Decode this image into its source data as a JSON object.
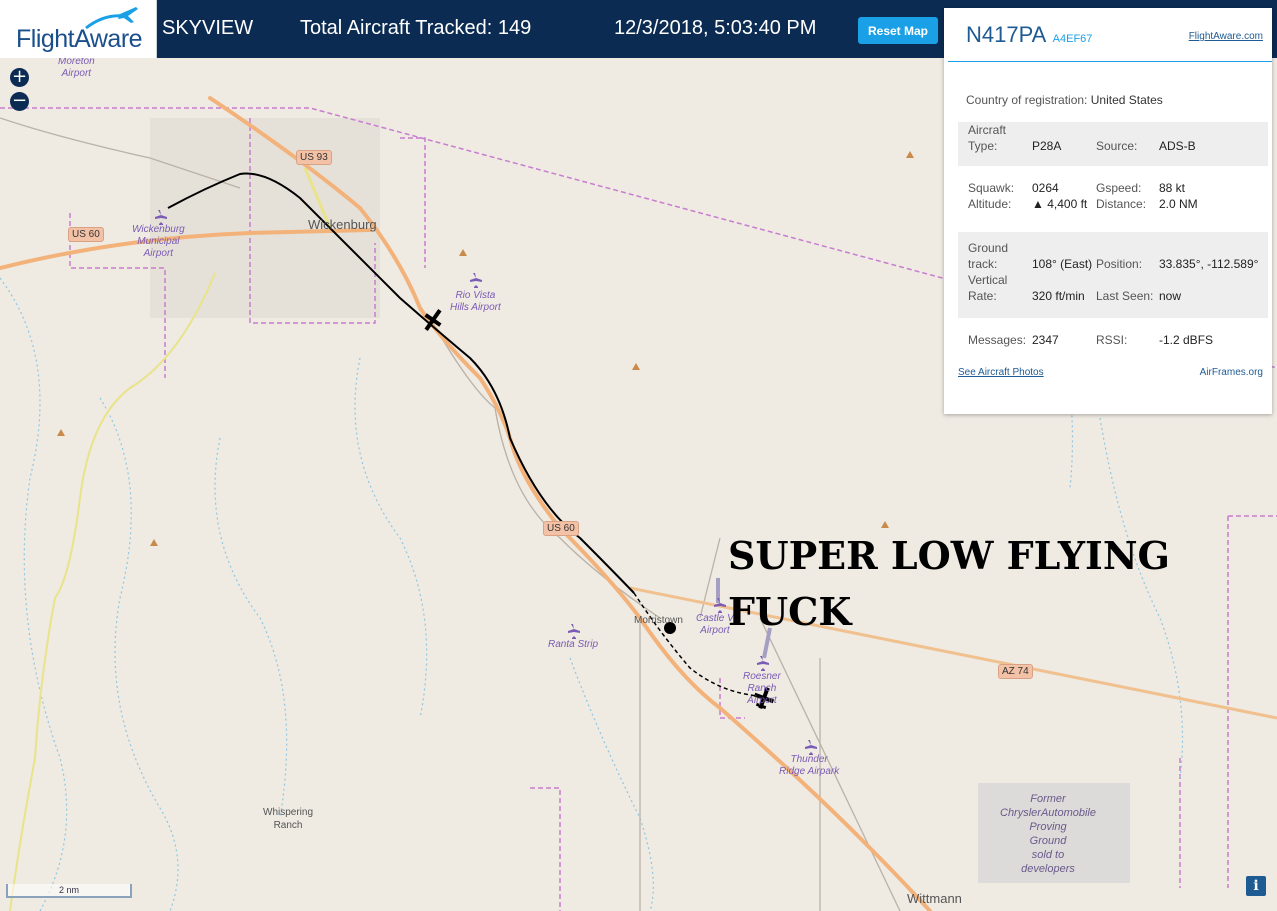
{
  "header": {
    "logo_text": "FlightAware",
    "app_name": "SKYVIEW",
    "total_tracked_label": "Total Aircraft Tracked: 149",
    "datetime": "12/3/2018, 5:03:40 PM",
    "reset_label": "Reset Map",
    "colors": {
      "bar": "#0b2b52",
      "accent": "#1aa0e6"
    }
  },
  "map": {
    "zoom_in": "+",
    "zoom_out": "−",
    "places": {
      "moreton": "Moreton\nAirport",
      "wickenburg": "Wickenburg",
      "wickenburg_airport": "Wickenburg\nMunicipal\nAirport",
      "rio_vista": "Rio Vista\nHills Airport",
      "morristown": "Morristown",
      "castle": "Castle V\nAirport",
      "ranta": "Ranta Strip",
      "roesner": "Roesner\nRanch\nAirport",
      "thunder": "Thunder\nRidge Airpark",
      "whispering": "Whispering\nRanch",
      "chrysler": "Former\nChryslerAutomobile\nProving\nGround\nsold to\ndevelopers",
      "wittmann": "Wittmann"
    },
    "shields": {
      "us93": "US 93",
      "us60_a": "US 60",
      "us60_b": "US 60",
      "az74": "AZ 74"
    },
    "annotation": "SUPER LOW FLYING FUCK",
    "scale": "2 nm",
    "info_icon": "i"
  },
  "panel": {
    "callsign": "N417PA",
    "hex": "A4EF67",
    "fa_link": "FlightAware.com",
    "country_label": "Country of registration:",
    "country_value": "United States",
    "type_label": "Aircraft\nType:",
    "type_value": "P28A",
    "source_label": "Source:",
    "source_value": "ADS-B",
    "squawk_label": "Squawk:",
    "squawk_value": "0264",
    "altitude_label": "Altitude:",
    "altitude_value": "▲ 4,400 ft",
    "gspeed_label": "Gspeed:",
    "gspeed_value": "88 kt",
    "distance_label": "Distance:",
    "distance_value": "2.0 NM",
    "track_label": "Ground\ntrack:",
    "track_value": "108° (East)",
    "position_label": "Position:",
    "position_value": "33.835°, -112.589°",
    "vrate_label": "Vertical\nRate:",
    "vrate_value": "320 ft/min",
    "lastseen_label": "Last Seen:",
    "lastseen_value": "now",
    "messages_label": "Messages:",
    "messages_value": "2347",
    "rssi_label": "RSSI:",
    "rssi_value": "-1.2 dBFS",
    "photos_link": "See Aircraft Photos",
    "airframes_link": "AirFrames.org"
  }
}
